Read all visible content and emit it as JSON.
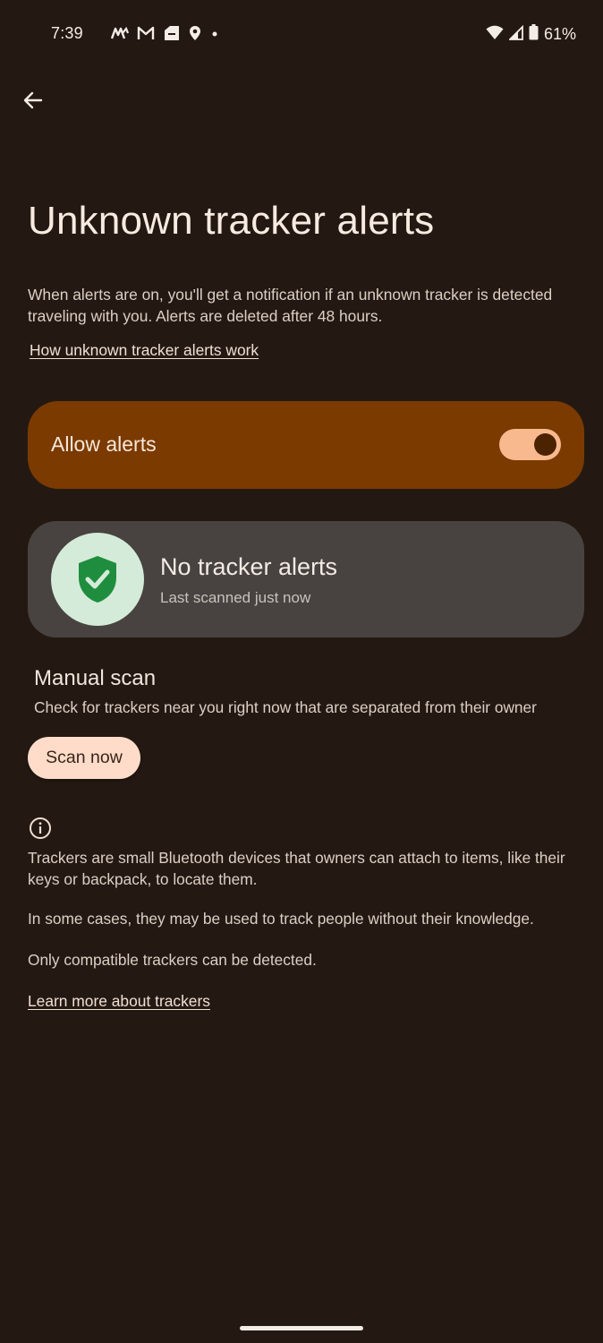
{
  "status_bar": {
    "time": "7:39",
    "left_icons": [
      "app-icon",
      "gmail-icon",
      "files-icon",
      "location-icon",
      "dot-icon"
    ],
    "right_icons": [
      "wifi-icon",
      "signal-icon",
      "battery-icon"
    ],
    "battery": "61%"
  },
  "header": {
    "back_icon": "back-arrow-icon",
    "title": "Unknown tracker alerts"
  },
  "intro": {
    "description": "When alerts are on, you'll get a notification if an unknown tracker is detected traveling with you. Alerts are deleted after 48 hours.",
    "link": "How unknown tracker alerts work"
  },
  "allow_alerts": {
    "label": "Allow alerts",
    "enabled": true
  },
  "status_card": {
    "icon": "shield-check-icon",
    "title": "No tracker alerts",
    "subtitle": "Last scanned just now"
  },
  "manual_scan": {
    "title": "Manual scan",
    "description": "Check for trackers near you right now that are separated from their owner",
    "button": "Scan now"
  },
  "info": {
    "icon": "info-icon",
    "paragraphs": [
      "Trackers are small Bluetooth devices that owners can attach to items, like their keys or backpack, to locate them.",
      "In some cases, they may be used to track people without their knowledge.",
      "Only compatible trackers can be detected."
    ],
    "link": "Learn more about trackers"
  },
  "colors": {
    "background": "#241912",
    "allow_card": "#7b3a00",
    "toggle_track": "#f7b98d",
    "status_card": "#484340",
    "shield_green": "#1e8e3e",
    "scan_button": "#ffdcca"
  }
}
